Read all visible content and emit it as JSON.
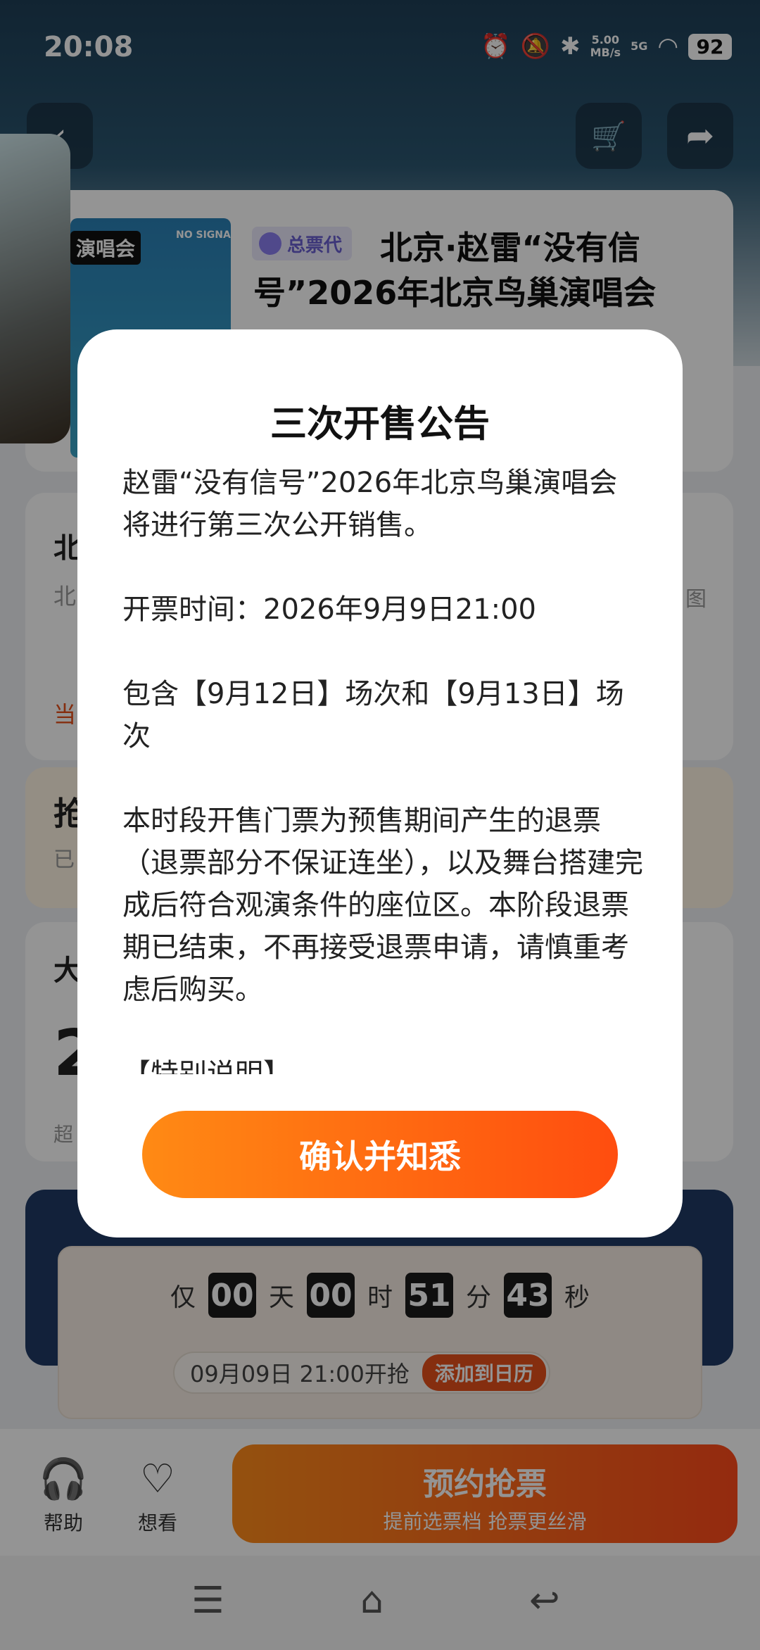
{
  "status_bar": {
    "time": "20:08",
    "net_speed_value": "5.00",
    "net_speed_unit": "MB/s",
    "signal": "5G",
    "battery": "92",
    "icons": [
      "alarm-icon",
      "bell-off-icon",
      "bluetooth-icon",
      "signal-icon",
      "wifi-icon"
    ]
  },
  "header": {
    "back_icon": "‹",
    "cart_icon": "🛒",
    "share_icon": "➦"
  },
  "event": {
    "poster_tag": "演唱会",
    "poster_note": "NO SIGNAL",
    "agent_badge": "总票代",
    "title": "北京·赵雷“没有信号”2026年北京鸟巢演唱会",
    "fragments": {
      "f1": "北",
      "f2": "北",
      "f3": "图",
      "f4": "当",
      "f5": "抢",
      "f6": "已",
      "f7": "大",
      "f8": "2",
      "f9": "超"
    }
  },
  "countdown": {
    "prefix": "仅",
    "days": "00",
    "days_unit": "天",
    "hours": "00",
    "hours_unit": "时",
    "minutes": "51",
    "minutes_unit": "分",
    "seconds": "43",
    "seconds_unit": "秒",
    "sale_time": "09月09日 21:00开抢",
    "add_calendar": "添加到日历"
  },
  "bottom_bar": {
    "help_label": "帮助",
    "want_label": "想看",
    "reserve_main": "预约抢票",
    "reserve_sub": "提前选票档 抢票更丝滑"
  },
  "dialog": {
    "title": "三次开售公告",
    "paragraphs": [
      "赵雷“没有信号”2026年北京鸟巢演唱会将进行第三次公开销售。",
      "开票时间：2026年9月9日21:00",
      "包含【9月12日】场次和【9月13日】场次",
      "本时段开售门票为预售期间产生的退票（退票部分不保证连坐），以及舞台搭建完成后符合观演条件的座位区。本阶段退票期已结束，不再接受退票申请，请慎重考虑后购买。",
      "【特别说明】"
    ],
    "confirm_label": "确认并知悉"
  },
  "colors": {
    "accent_orange": "#ff5a14",
    "badge_purple": "#6a5fd0"
  }
}
